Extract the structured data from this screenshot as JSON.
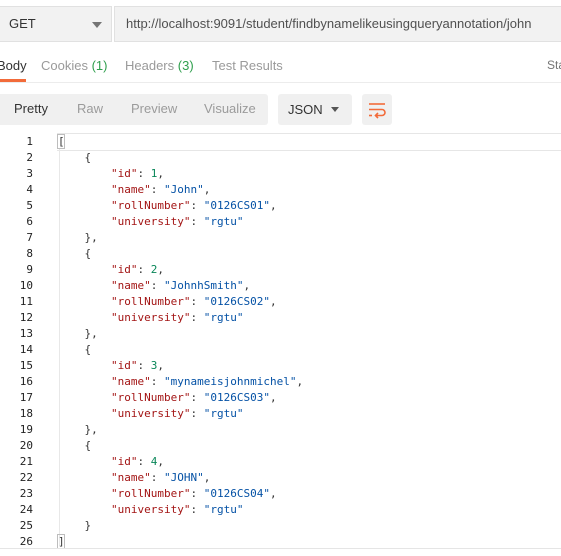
{
  "request": {
    "method": "GET",
    "url": "http://localhost:9091/student/findbynamelikeusingqueryannotation/john"
  },
  "response_tabs": [
    {
      "label": "Body",
      "count": ""
    },
    {
      "label": "Cookies",
      "count": "(1)"
    },
    {
      "label": "Headers",
      "count": "(3)"
    },
    {
      "label": "Test Results",
      "count": ""
    }
  ],
  "status_label": "Sta",
  "format": {
    "modes": [
      "Pretty",
      "Raw",
      "Preview",
      "Visualize"
    ],
    "active_mode": "Pretty",
    "language": "JSON",
    "wrap_icon": "wrap-lines-icon"
  },
  "code_lines": [
    "[",
    "    {",
    "        \"id\": 1,",
    "        \"name\": \"John\",",
    "        \"rollNumber\": \"0126CS01\",",
    "        \"university\": \"rgtu\"",
    "    },",
    "    {",
    "        \"id\": 2,",
    "        \"name\": \"JohnhSmith\",",
    "        \"rollNumber\": \"0126CS02\",",
    "        \"university\": \"rgtu\"",
    "    },",
    "    {",
    "        \"id\": 3,",
    "        \"name\": \"mynameisjohnmichel\",",
    "        \"rollNumber\": \"0126CS03\",",
    "        \"university\": \"rgtu\"",
    "    },",
    "    {",
    "        \"id\": 4,",
    "        \"name\": \"JOHN\",",
    "        \"rollNumber\": \"0126CS04\",",
    "        \"university\": \"rgtu\"",
    "    }",
    "]"
  ],
  "colors": {
    "accent": "#f26b3a",
    "count_green": "#2f9f4d",
    "json_key": "#a31515",
    "json_string": "#0451a5",
    "json_number": "#098658"
  }
}
